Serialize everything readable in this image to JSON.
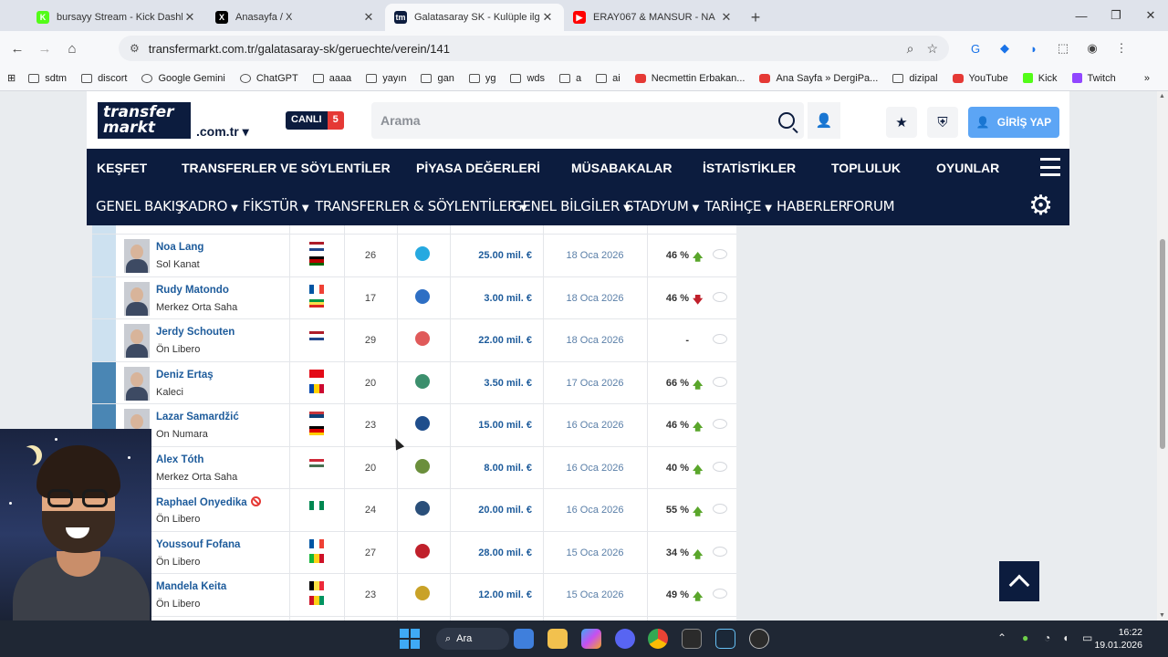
{
  "browser": {
    "tabs": [
      {
        "title": "bursayy Stream - Kick Dashboar",
        "fav": "K",
        "color": "#53fc18",
        "active": false
      },
      {
        "title": "Anasayfa / X",
        "fav": "X",
        "color": "#000000",
        "active": false
      },
      {
        "title": "Galatasaray SK - Kulüple ilgili tr",
        "fav": "tm",
        "color": "#0c1c3e",
        "active": true
      },
      {
        "title": "ERAY067 & MANSUR - NA",
        "fav": "▶",
        "color": "#ff0000",
        "active": false
      }
    ],
    "url": "transfermarkt.com.tr/galatasaray-sk/geruechte/verein/141",
    "bookmarks": [
      "sdtm",
      "discort",
      "Google Gemini",
      "ChatGPT",
      "aaaa",
      "yayın",
      "gan",
      "yg",
      "wds",
      "a",
      "ai",
      "Necmettin Erbakan...",
      "Ana Sayfa » DergiPa...",
      "dizipal",
      "YouTube",
      "Kick",
      "Twitch"
    ]
  },
  "header": {
    "logo_line1": "transfer",
    "logo_line2": "markt",
    "logo_suffix": ".com.tr",
    "live_label": "CANLI",
    "live_count": "5",
    "search_placeholder": "Arama",
    "login_label": "GİRİŞ YAP"
  },
  "main_nav": [
    "KEŞFET",
    "TRANSFERLER VE SÖYLENTİLER",
    "PİYASA DEĞERLERİ",
    "MÜSABAKALAR",
    "İSTATİSTİKLER",
    "TOPLULUK",
    "OYUNLAR"
  ],
  "sub_nav": [
    {
      "label": "GENEL BAKIŞ",
      "caret": false
    },
    {
      "label": "KADRO",
      "caret": true
    },
    {
      "label": "FİKSTÜR",
      "caret": true
    },
    {
      "label": "TRANSFERLER & SÖYLENTİLER",
      "caret": true
    },
    {
      "label": "GENEL BİLGİLER",
      "caret": true
    },
    {
      "label": "STADYUM",
      "caret": true
    },
    {
      "label": "TARİHÇE",
      "caret": true
    },
    {
      "label": "HABERLER",
      "caret": false
    },
    {
      "label": "FORUM",
      "caret": false
    }
  ],
  "rumours": [
    {
      "name": "Noa Lang",
      "position": "Sol Kanat",
      "flags": [
        "nl",
        "ke"
      ],
      "age": "26",
      "club_color": "#26a9e0",
      "value": "25.00 mil. €",
      "date": "18 Oca 2026",
      "pct": "46 %",
      "trend": "up",
      "banned": false
    },
    {
      "name": "Rudy Matondo",
      "position": "Merkez Orta Saha",
      "flags": [
        "fr",
        "cg"
      ],
      "age": "17",
      "club_color": "#2e6fc4",
      "value": "3.00 mil. €",
      "date": "18 Oca 2026",
      "pct": "46 %",
      "trend": "down",
      "banned": false
    },
    {
      "name": "Jerdy Schouten",
      "position": "Ön Libero",
      "flags": [
        "nl"
      ],
      "age": "29",
      "club_color": "#e05a5a",
      "value": "22.00 mil. €",
      "date": "18 Oca 2026",
      "pct": "-",
      "trend": "none",
      "banned": false
    },
    {
      "name": "Deniz Ertaş",
      "position": "Kaleci",
      "flags": [
        "tr",
        "md"
      ],
      "age": "20",
      "club_color": "#3c8f6d",
      "value": "3.50 mil. €",
      "date": "17 Oca 2026",
      "pct": "66 %",
      "trend": "up",
      "banned": false
    },
    {
      "name": "Lazar Samardžić",
      "position": "On Numara",
      "flags": [
        "rs",
        "de"
      ],
      "age": "23",
      "club_color": "#1f4e8c",
      "value": "15.00 mil. €",
      "date": "16 Oca 2026",
      "pct": "46 %",
      "trend": "up",
      "banned": false
    },
    {
      "name": "Alex Tóth",
      "position": "Merkez Orta Saha",
      "flags": [
        "hu"
      ],
      "age": "20",
      "club_color": "#6b8f3c",
      "value": "8.00 mil. €",
      "date": "16 Oca 2026",
      "pct": "40 %",
      "trend": "up",
      "banned": false
    },
    {
      "name": "Raphael Onyedika",
      "position": "Ön Libero",
      "flags": [
        "ng"
      ],
      "age": "24",
      "club_color": "#2a4f7a",
      "value": "20.00 mil. €",
      "date": "16 Oca 2026",
      "pct": "55 %",
      "trend": "up",
      "banned": true
    },
    {
      "name": "Youssouf Fofana",
      "position": "Ön Libero",
      "flags": [
        "fr",
        "ml"
      ],
      "age": "27",
      "club_color": "#c0202b",
      "value": "28.00 mil. €",
      "date": "15 Oca 2026",
      "pct": "34 %",
      "trend": "up",
      "banned": false
    },
    {
      "name": "Mandela Keita",
      "position": "Ön Libero",
      "flags": [
        "be",
        "gn"
      ],
      "age": "23",
      "club_color": "#c9a227",
      "value": "12.00 mil. €",
      "date": "15 Oca 2026",
      "pct": "49 %",
      "trend": "up",
      "banned": false
    }
  ],
  "taskbar": {
    "search_label": "Ara",
    "time": "16:22",
    "date": "19.01.2026"
  },
  "colors": {
    "navy": "#0c1c3e",
    "link_blue": "#1d5b9b",
    "trend_up": "#5aa62b",
    "trend_down": "#c0202b",
    "login_blue": "#5ca5f5"
  }
}
